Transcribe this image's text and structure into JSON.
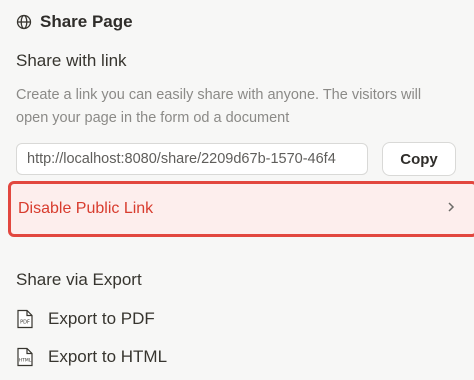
{
  "header": {
    "title": "Share Page",
    "icon": "globe-icon"
  },
  "share_link": {
    "title": "Share with link",
    "description": "Create a link you can easily share with anyone. The visitors will open your page in the form od a document",
    "url_value": "http://localhost:8080/share/2209d67b-1570-46f4",
    "copy_label": "Copy",
    "disable_label": "Disable Public Link",
    "disable_icon": "chevron-right-icon",
    "disable_color": "#d83c2e"
  },
  "export": {
    "title": "Share via Export",
    "items": [
      {
        "label": "Export to PDF",
        "icon": "pdf-file-icon",
        "icon_text": "PDF"
      },
      {
        "label": "Export to HTML",
        "icon": "html-file-icon",
        "icon_text": "HTML"
      }
    ]
  }
}
